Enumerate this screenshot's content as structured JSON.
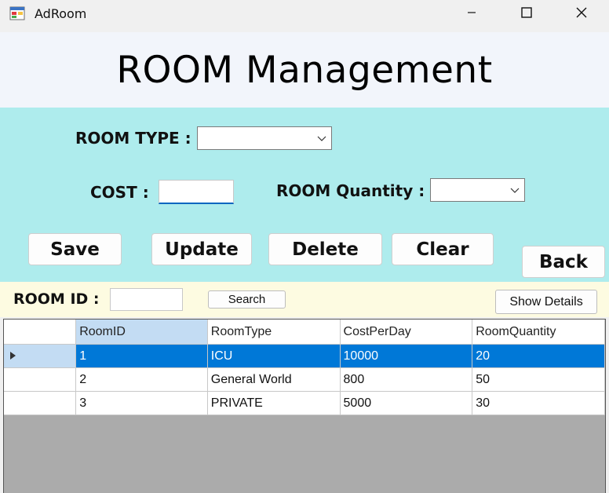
{
  "window": {
    "title": "AdRoom"
  },
  "header": {
    "title": "ROOM Management"
  },
  "form": {
    "room_type_label": "ROOM TYPE :",
    "room_type_value": "",
    "cost_label": "COST :",
    "cost_value": "",
    "room_quantity_label": "ROOM Quantity :",
    "room_quantity_value": ""
  },
  "buttons": {
    "save": "Save",
    "update": "Update",
    "delete": "Delete",
    "clear": "Clear",
    "back": "Back"
  },
  "search": {
    "room_id_label": "ROOM ID :",
    "room_id_value": "",
    "search_label": "Search",
    "show_details_label": "Show Details"
  },
  "grid": {
    "columns": [
      "RoomID",
      "RoomType",
      "CostPerDay",
      "RoomQuantity"
    ],
    "rows": [
      [
        "1",
        "ICU",
        "10000",
        "20"
      ],
      [
        "2",
        "General World",
        "800",
        "50"
      ],
      [
        "3",
        "PRIVATE",
        "5000",
        "30"
      ]
    ],
    "selected_row": 0
  },
  "colors": {
    "form_panel": "#aeeced",
    "header_bg": "#f2f5fb",
    "search_bar": "#fdfbe1",
    "selection": "#0078d7",
    "grid_empty": "#ababab"
  }
}
